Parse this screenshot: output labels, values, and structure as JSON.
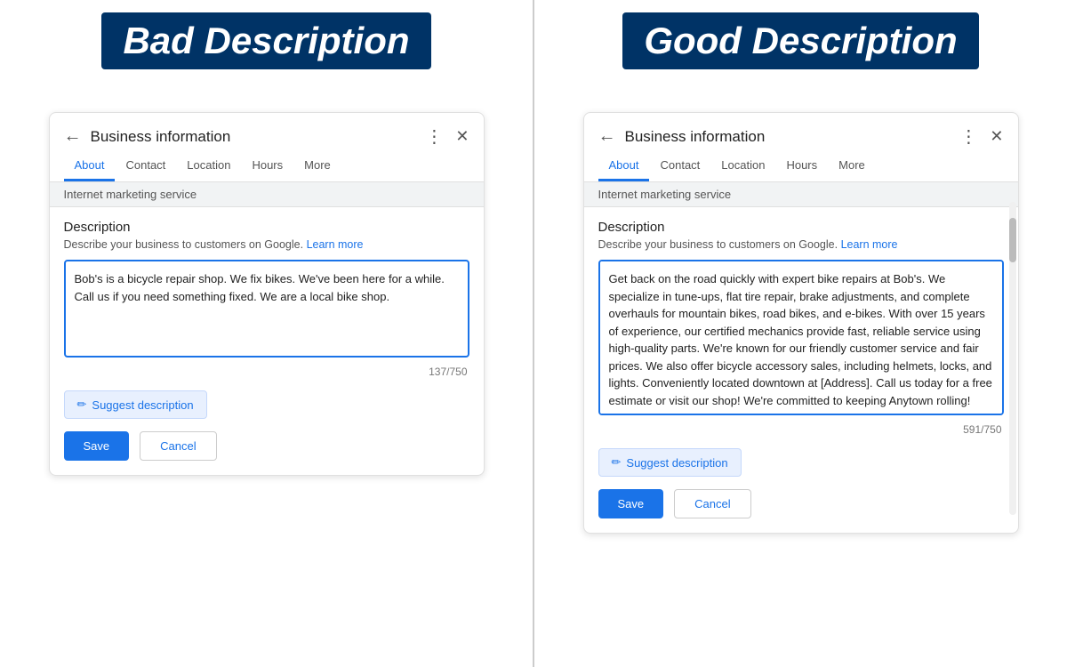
{
  "left": {
    "title": "Bad Description",
    "card": {
      "header_title": "Business information",
      "tabs": [
        "About",
        "Contact",
        "Location",
        "Hours",
        "More"
      ],
      "active_tab": "About",
      "business_name": "Internet marketing service",
      "section_title": "Description",
      "section_sub": "Describe your business to customers on Google.",
      "learn_more": "Learn more",
      "description_text": "Bob's is a bicycle repair shop. We fix bikes. We've been here for a while. Call us if you need something fixed. We are a local bike shop.",
      "char_count": "137/750",
      "suggest_label": "Suggest description",
      "save_label": "Save",
      "cancel_label": "Cancel"
    }
  },
  "right": {
    "title": "Good Description",
    "card": {
      "header_title": "Business information",
      "tabs": [
        "About",
        "Contact",
        "Location",
        "Hours",
        "More"
      ],
      "active_tab": "About",
      "business_name": "Internet marketing service",
      "section_title": "Description",
      "section_sub": "Describe your business to customers on Google.",
      "learn_more": "Learn more",
      "description_text": "Get back on the road quickly with expert bike repairs at Bob's. We specialize in tune-ups, flat tire repair, brake adjustments, and complete overhauls for mountain bikes, road bikes, and e-bikes. With over 15 years of experience, our certified mechanics provide fast, reliable service using high-quality parts. We're known for our friendly customer service and fair prices. We also offer bicycle accessory sales, including helmets, locks, and lights. Conveniently located downtown at [Address]. Call us today for a free estimate or visit our shop! We're committed to keeping Anytown rolling!",
      "char_count": "591/750",
      "suggest_label": "Suggest description",
      "save_label": "Save",
      "cancel_label": "Cancel"
    }
  },
  "icons": {
    "back": "←",
    "dots": "⋮",
    "close": "✕",
    "pencil": "✏"
  }
}
